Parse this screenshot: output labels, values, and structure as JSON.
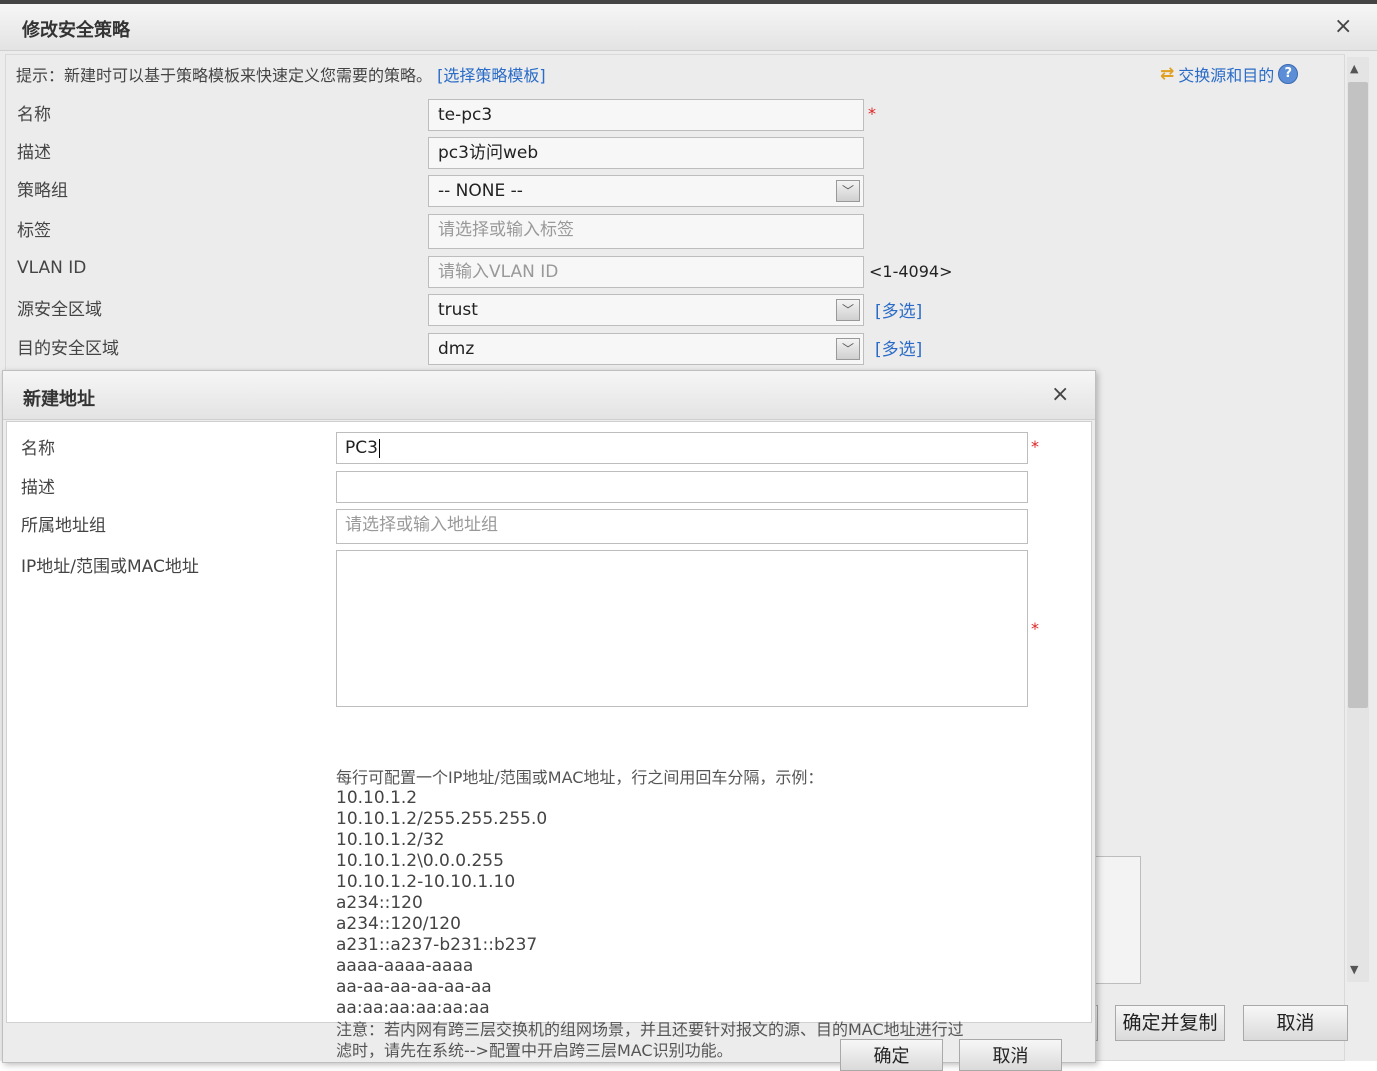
{
  "outer_dialog": {
    "title": "修改安全策略",
    "hint_text": "提示：新建时可以基于策略模板来快速定义您需要的策略。",
    "template_link": "[选择策略模板]",
    "swap_link": "交换源和目的",
    "fields": {
      "name_label": "名称",
      "name_value": "te-pc3",
      "desc_label": "描述",
      "desc_value": "pc3访问web",
      "group_label": "策略组",
      "group_value": "-- NONE --",
      "tag_label": "标签",
      "tag_placeholder": "请选择或输入标签",
      "vlan_label": "VLAN ID",
      "vlan_placeholder": "请输入VLAN ID",
      "vlan_range": "<1-4094>",
      "src_zone_label": "源安全区域",
      "src_zone_value": "trust",
      "dst_zone_label": "目的安全区域",
      "dst_zone_value": "dmz",
      "multi_select": "[多选]"
    },
    "buttons": {
      "confirm_copy": "确定并复制",
      "cancel": "取消"
    }
  },
  "inner_dialog": {
    "title": "新建地址",
    "fields": {
      "name_label": "名称",
      "name_value": "PC3",
      "desc_label": "描述",
      "desc_value": "",
      "group_label": "所属地址组",
      "group_placeholder": "请选择或输入地址组",
      "ip_label": "IP地址/范围或MAC地址",
      "ip_value": ""
    },
    "help_intro": "每行可配置一个IP地址/范围或MAC地址，行之间用回车分隔，示例：",
    "examples": [
      "10.10.1.2",
      "10.10.1.2/255.255.255.0",
      "10.10.1.2/32",
      "10.10.1.2\\0.0.0.255",
      "10.10.1.2-10.10.1.10",
      "a234::120",
      "a234::120/120",
      "a231::a237-b231::b237",
      "aaaa-aaaa-aaaa",
      "aa-aa-aa-aa-aa-aa",
      "aa:aa:aa:aa:aa:aa"
    ],
    "note_line1": "注意：若内网有跨三层交换机的组网场景，并且还要针对报文的源、目的MAC地址进行过",
    "note_line2": "滤时，请先在系统-->配置中开启跨三层MAC识别功能。",
    "buttons": {
      "ok": "确定",
      "cancel": "取消"
    }
  },
  "required_mark": "*",
  "close_glyph": "×",
  "colors": {
    "link": "#2a6cc7",
    "required": "#dd2222",
    "dialog_bg": "#ececec"
  }
}
